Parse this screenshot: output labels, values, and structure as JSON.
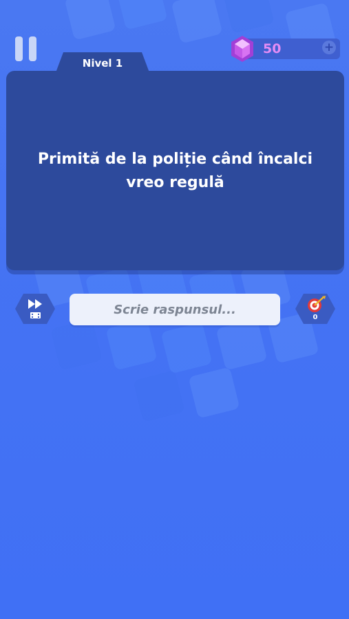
{
  "header": {
    "pause_icon": "pause-icon",
    "gems": {
      "icon": "gem-icon",
      "count": "50",
      "add_icon": "plus-icon"
    }
  },
  "level": {
    "label": "Nivel 1"
  },
  "question": {
    "line1": "Primită de la poliție când încalci",
    "line2": "vreo regulă"
  },
  "controls": {
    "skip_icon": "fast-forward-video-icon",
    "answer_placeholder": "Scrie raspunsul...",
    "hint_icon": "target-dart-icon",
    "hint_count": "0"
  },
  "colors": {
    "background": "#4573f3",
    "card": "#2d4a9c",
    "gem_text": "#e48cf5"
  }
}
